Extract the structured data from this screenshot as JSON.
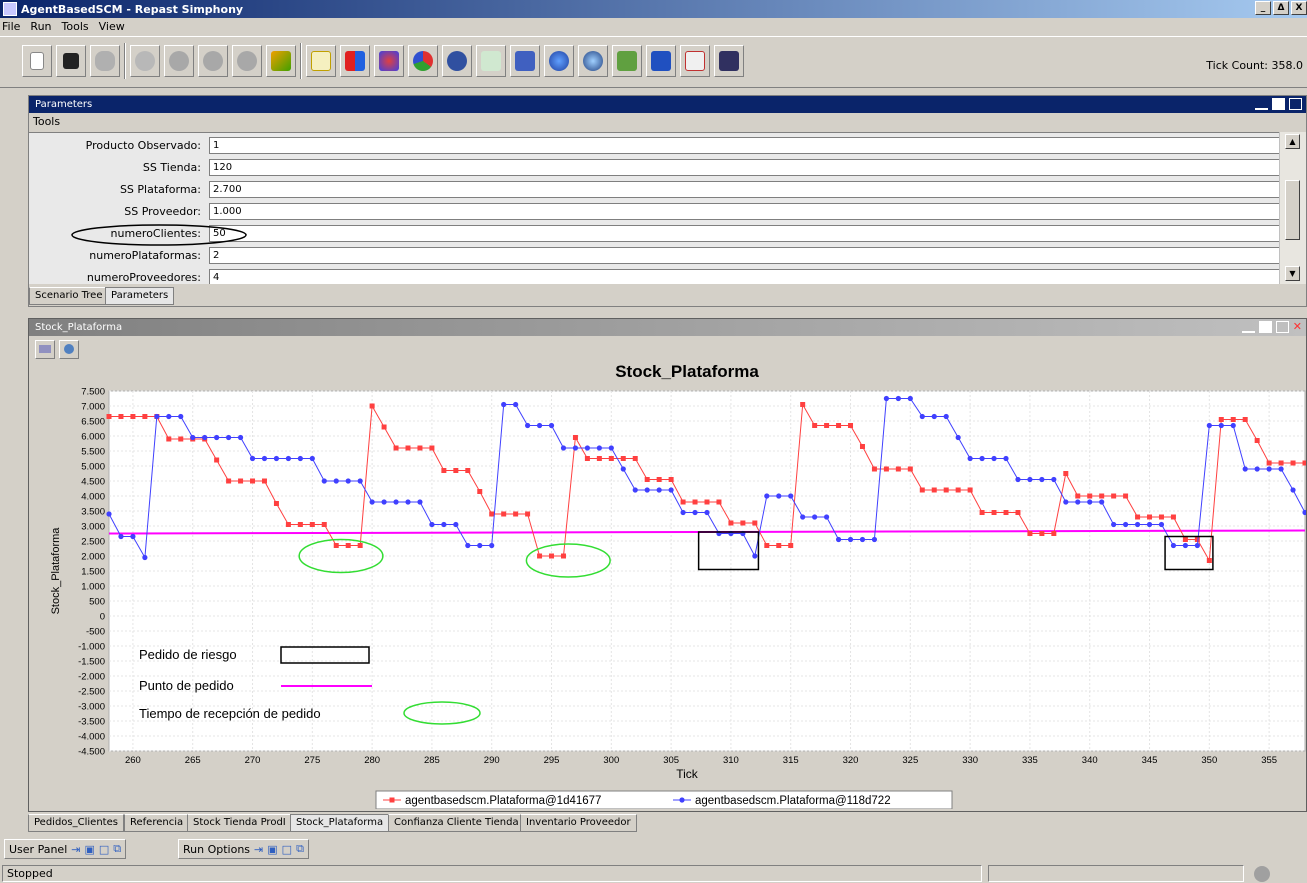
{
  "window": {
    "title": "AgentBasedSCM - Repast Simphony",
    "controls": [
      "_",
      "Δ",
      "X"
    ]
  },
  "menu": [
    "File",
    "Run",
    "Tools",
    "View"
  ],
  "toolbar": {
    "tick_count": "Tick Count: 358.0"
  },
  "parameters": {
    "title": "Parameters",
    "menu": "Tools",
    "rows": [
      {
        "label": "Producto Observado:",
        "value": "1"
      },
      {
        "label": "SS Tienda:",
        "value": "120"
      },
      {
        "label": "SS Plataforma:",
        "value": "2.700"
      },
      {
        "label": "SS Proveedor:",
        "value": "1.000"
      },
      {
        "label": "numeroClientes:",
        "value": "50"
      },
      {
        "label": "numeroPlataformas:",
        "value": "2"
      },
      {
        "label": "numeroProveedores:",
        "value": "4"
      }
    ],
    "tabs": [
      "Scenario Tree",
      "Parameters"
    ]
  },
  "chart_window": {
    "title": "Stock_Plataforma"
  },
  "chart_data": {
    "type": "line",
    "title": "Stock_Plataforma",
    "xlabel": "Tick",
    "ylabel": "Stock_Plataforma",
    "xlim": [
      258,
      358
    ],
    "ylim": [
      -4500,
      7500
    ],
    "xticks": [
      260,
      265,
      270,
      275,
      280,
      285,
      290,
      295,
      300,
      305,
      310,
      315,
      320,
      325,
      330,
      335,
      340,
      345,
      350,
      355
    ],
    "yticks": [
      {
        "v": 7500,
        "t": "7.500"
      },
      {
        "v": 7000,
        "t": "7.000"
      },
      {
        "v": 6500,
        "t": "6.500"
      },
      {
        "v": 6000,
        "t": "6.000"
      },
      {
        "v": 5500,
        "t": "5.500"
      },
      {
        "v": 5000,
        "t": "5.000"
      },
      {
        "v": 4500,
        "t": "4.500"
      },
      {
        "v": 4000,
        "t": "4.000"
      },
      {
        "v": 3500,
        "t": "3.500"
      },
      {
        "v": 3000,
        "t": "3.000"
      },
      {
        "v": 2500,
        "t": "2.500"
      },
      {
        "v": 2000,
        "t": "2.000"
      },
      {
        "v": 1500,
        "t": "1.500"
      },
      {
        "v": 1000,
        "t": "1.000"
      },
      {
        "v": 500,
        "t": "500"
      },
      {
        "v": 0,
        "t": "0"
      },
      {
        "v": -500,
        "t": "-500"
      },
      {
        "v": -1000,
        "t": "-1.000"
      },
      {
        "v": -1500,
        "t": "-1.500"
      },
      {
        "v": -2000,
        "t": "-2.000"
      },
      {
        "v": -2500,
        "t": "-2.500"
      },
      {
        "v": -3000,
        "t": "-3.000"
      },
      {
        "v": -3500,
        "t": "-3.500"
      },
      {
        "v": -4000,
        "t": "-4.000"
      },
      {
        "v": -4500,
        "t": "-4.500"
      }
    ],
    "grid": true,
    "legend_position": "bottom",
    "series": [
      {
        "name": "agentbasedscm.Plataforma@1d41677",
        "color": "#ff4040",
        "marker": "square",
        "points": [
          [
            258,
            6650
          ],
          [
            259,
            6650
          ],
          [
            260,
            6650
          ],
          [
            261,
            6650
          ],
          [
            262,
            6650
          ],
          [
            263,
            5900
          ],
          [
            264,
            5900
          ],
          [
            265,
            5900
          ],
          [
            266,
            5900
          ],
          [
            267,
            5200
          ],
          [
            268,
            4500
          ],
          [
            269,
            4500
          ],
          [
            270,
            4500
          ],
          [
            271,
            4500
          ],
          [
            272,
            3750
          ],
          [
            273,
            3050
          ],
          [
            274,
            3050
          ],
          [
            275,
            3050
          ],
          [
            276,
            3050
          ],
          [
            277,
            2350
          ],
          [
            278,
            2350
          ],
          [
            279,
            2350
          ],
          [
            280,
            7000
          ],
          [
            281,
            6300
          ],
          [
            282,
            5600
          ],
          [
            283,
            5600
          ],
          [
            284,
            5600
          ],
          [
            285,
            5600
          ],
          [
            286,
            4850
          ],
          [
            287,
            4850
          ],
          [
            288,
            4850
          ],
          [
            289,
            4150
          ],
          [
            290,
            3400
          ],
          [
            291,
            3400
          ],
          [
            292,
            3400
          ],
          [
            293,
            3400
          ],
          [
            294,
            2000
          ],
          [
            295,
            2000
          ],
          [
            296,
            2000
          ],
          [
            297,
            5950
          ],
          [
            298,
            5250
          ],
          [
            299,
            5250
          ],
          [
            300,
            5250
          ],
          [
            301,
            5250
          ],
          [
            302,
            5250
          ],
          [
            303,
            4550
          ],
          [
            304,
            4550
          ],
          [
            305,
            4550
          ],
          [
            306,
            3800
          ],
          [
            307,
            3800
          ],
          [
            308,
            3800
          ],
          [
            309,
            3800
          ],
          [
            310,
            3100
          ],
          [
            311,
            3100
          ],
          [
            312,
            3100
          ],
          [
            313,
            2350
          ],
          [
            314,
            2350
          ],
          [
            315,
            2350
          ],
          [
            316,
            7050
          ],
          [
            317,
            6350
          ],
          [
            318,
            6350
          ],
          [
            319,
            6350
          ],
          [
            320,
            6350
          ],
          [
            321,
            5650
          ],
          [
            322,
            4900
          ],
          [
            323,
            4900
          ],
          [
            324,
            4900
          ],
          [
            325,
            4900
          ],
          [
            326,
            4200
          ],
          [
            327,
            4200
          ],
          [
            328,
            4200
          ],
          [
            329,
            4200
          ],
          [
            330,
            4200
          ],
          [
            331,
            3450
          ],
          [
            332,
            3450
          ],
          [
            333,
            3450
          ],
          [
            334,
            3450
          ],
          [
            335,
            2750
          ],
          [
            336,
            2750
          ],
          [
            337,
            2750
          ],
          [
            338,
            4750
          ],
          [
            339,
            4000
          ],
          [
            340,
            4000
          ],
          [
            341,
            4000
          ],
          [
            342,
            4000
          ],
          [
            343,
            4000
          ],
          [
            344,
            3300
          ],
          [
            345,
            3300
          ],
          [
            346,
            3300
          ],
          [
            347,
            3300
          ],
          [
            348,
            2550
          ],
          [
            349,
            2550
          ],
          [
            350,
            1850
          ],
          [
            351,
            6550
          ],
          [
            352,
            6550
          ],
          [
            353,
            6550
          ],
          [
            354,
            5850
          ],
          [
            355,
            5100
          ],
          [
            356,
            5100
          ],
          [
            357,
            5100
          ],
          [
            358,
            5100
          ]
        ]
      },
      {
        "name": "agentbasedscm.Plataforma@118d722",
        "color": "#4040ff",
        "marker": "circle",
        "points": [
          [
            258,
            3400
          ],
          [
            259,
            2650
          ],
          [
            260,
            2650
          ],
          [
            261,
            1950
          ],
          [
            262,
            6650
          ],
          [
            263,
            6650
          ],
          [
            264,
            6650
          ],
          [
            265,
            5950
          ],
          [
            266,
            5950
          ],
          [
            267,
            5950
          ],
          [
            268,
            5950
          ],
          [
            269,
            5950
          ],
          [
            270,
            5250
          ],
          [
            271,
            5250
          ],
          [
            272,
            5250
          ],
          [
            273,
            5250
          ],
          [
            274,
            5250
          ],
          [
            275,
            5250
          ],
          [
            276,
            4500
          ],
          [
            277,
            4500
          ],
          [
            278,
            4500
          ],
          [
            279,
            4500
          ],
          [
            280,
            3800
          ],
          [
            281,
            3800
          ],
          [
            282,
            3800
          ],
          [
            283,
            3800
          ],
          [
            284,
            3800
          ],
          [
            285,
            3050
          ],
          [
            286,
            3050
          ],
          [
            287,
            3050
          ],
          [
            288,
            2350
          ],
          [
            289,
            2350
          ],
          [
            290,
            2350
          ],
          [
            291,
            7050
          ],
          [
            292,
            7050
          ],
          [
            293,
            6350
          ],
          [
            294,
            6350
          ],
          [
            295,
            6350
          ],
          [
            296,
            5600
          ],
          [
            297,
            5600
          ],
          [
            298,
            5600
          ],
          [
            299,
            5600
          ],
          [
            300,
            5600
          ],
          [
            301,
            4900
          ],
          [
            302,
            4200
          ],
          [
            303,
            4200
          ],
          [
            304,
            4200
          ],
          [
            305,
            4200
          ],
          [
            306,
            3450
          ],
          [
            307,
            3450
          ],
          [
            308,
            3450
          ],
          [
            309,
            2750
          ],
          [
            310,
            2750
          ],
          [
            311,
            2750
          ],
          [
            312,
            2000
          ],
          [
            313,
            4000
          ],
          [
            314,
            4000
          ],
          [
            315,
            4000
          ],
          [
            316,
            3300
          ],
          [
            317,
            3300
          ],
          [
            318,
            3300
          ],
          [
            319,
            2550
          ],
          [
            320,
            2550
          ],
          [
            321,
            2550
          ],
          [
            322,
            2550
          ],
          [
            323,
            7250
          ],
          [
            324,
            7250
          ],
          [
            325,
            7250
          ],
          [
            326,
            6650
          ],
          [
            327,
            6650
          ],
          [
            328,
            6650
          ],
          [
            329,
            5950
          ],
          [
            330,
            5250
          ],
          [
            331,
            5250
          ],
          [
            332,
            5250
          ],
          [
            333,
            5250
          ],
          [
            334,
            4550
          ],
          [
            335,
            4550
          ],
          [
            336,
            4550
          ],
          [
            337,
            4550
          ],
          [
            338,
            3800
          ],
          [
            339,
            3800
          ],
          [
            340,
            3800
          ],
          [
            341,
            3800
          ],
          [
            342,
            3050
          ],
          [
            343,
            3050
          ],
          [
            344,
            3050
          ],
          [
            345,
            3050
          ],
          [
            346,
            3050
          ],
          [
            347,
            2350
          ],
          [
            348,
            2350
          ],
          [
            349,
            2350
          ],
          [
            350,
            6350
          ],
          [
            351,
            6350
          ],
          [
            352,
            6350
          ],
          [
            353,
            4900
          ],
          [
            354,
            4900
          ],
          [
            355,
            4900
          ],
          [
            356,
            4900
          ],
          [
            357,
            4200
          ],
          [
            358,
            3450
          ]
        ]
      }
    ],
    "reference_line": {
      "color": "#ff00ff",
      "from": [
        258,
        2750
      ],
      "to": [
        358,
        2850
      ]
    },
    "annotations": {
      "risk_boxes": [
        {
          "x1": 307.3,
          "x2": 312.3,
          "y1": 2800,
          "y2": 1550
        },
        {
          "x1": 346.3,
          "x2": 350.3,
          "y1": 2650,
          "y2": 1550
        }
      ],
      "ellipses": [
        {
          "cx": 277.4,
          "cy": 2000,
          "rx": 3.5,
          "ry": 550
        },
        {
          "cx": 296.4,
          "cy": 1850,
          "rx": 3.5,
          "ry": 550
        }
      ],
      "legend": [
        {
          "label": "Pedido de riesgo",
          "kind": "box"
        },
        {
          "label": "Punto de pedido",
          "kind": "line"
        },
        {
          "label": "Tiempo de recepción de pedido",
          "kind": "ellipse"
        }
      ]
    },
    "colors": {
      "risk_box": "#000000",
      "ellipse": "#33dd33"
    }
  },
  "bottom_tabs": [
    "Pedidos_Clientes",
    "Referencia",
    "Stock Tienda ProdI",
    "Stock_Plataforma",
    "Confianza Cliente Tienda",
    "Inventario Proveedor"
  ],
  "panels": {
    "user_panel": "User Panel",
    "run_options": "Run Options"
  },
  "status": {
    "text": "Stopped"
  }
}
